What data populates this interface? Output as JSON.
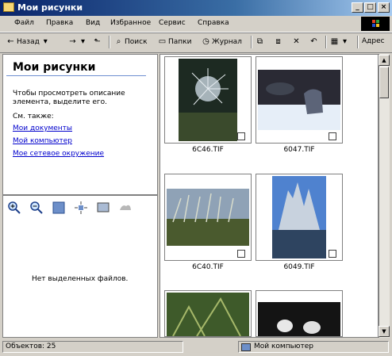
{
  "window": {
    "title": "Мои рисунки"
  },
  "menu": [
    "Файл",
    "Правка",
    "Вид",
    "Избранное",
    "Сервис",
    "Справка"
  ],
  "toolbar": {
    "back": "Назад",
    "search": "Поиск",
    "folders": "Папки",
    "history": "Журнал",
    "address": "Адрес"
  },
  "left_panel": {
    "heading": "Мои рисунки",
    "hint_line1": "Чтобы просмотреть описание",
    "hint_line2": "элемента, выделите его.",
    "see_also": "См. также:",
    "links": [
      "Мои документы",
      "Мой компьютер",
      "Мое сетевое окружение"
    ]
  },
  "preview": {
    "empty_text": "Нет выделенных файлов."
  },
  "files": [
    {
      "name": "6C46.TIF"
    },
    {
      "name": "6047.TIF"
    },
    {
      "name": "6C40.TIF"
    },
    {
      "name": "6049.TIF"
    }
  ],
  "status": {
    "objects": "Объектов: 25",
    "location": "Мой компьютер"
  }
}
